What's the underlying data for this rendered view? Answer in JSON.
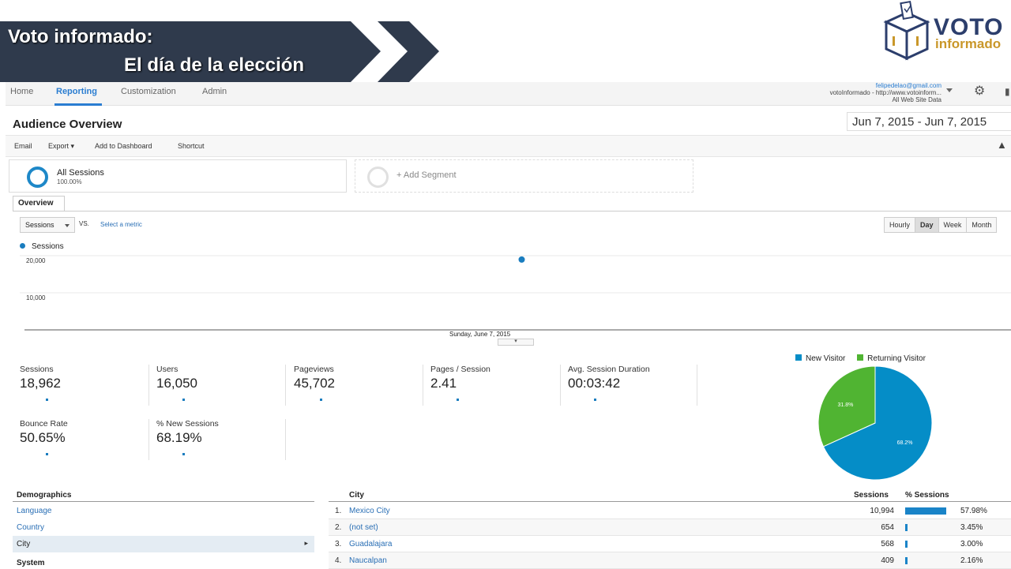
{
  "banner": {
    "line1": "Voto informado:",
    "line2": "El día de la elección"
  },
  "logo": {
    "word1": "VOTO",
    "word2": "informado"
  },
  "nav": {
    "items": [
      "Home",
      "Reporting",
      "Customization",
      "Admin"
    ],
    "active": "Reporting"
  },
  "account": {
    "email": "felipedelao@gmail.com",
    "property": "votoInformado - http://www.votoinform...",
    "view": "All Web Site Data"
  },
  "page": {
    "title": "Audience Overview",
    "date_range": "Jun 7, 2015 - Jun 7, 2015"
  },
  "actions": [
    "Email",
    "Export ▾",
    "Add to Dashboard",
    "Shortcut"
  ],
  "segments": {
    "all_name": "All Sessions",
    "all_pct": "100.00%",
    "add_label": "+ Add Segment"
  },
  "tabs": {
    "overview": "Overview"
  },
  "chart_controls": {
    "metric": "Sessions",
    "vs": "VS.",
    "select_metric": "Select a metric",
    "granularity": [
      "Hourly",
      "Day",
      "Week",
      "Month"
    ],
    "active_granularity": "Day"
  },
  "chart_data": {
    "type": "line",
    "series": [
      {
        "name": "Sessions",
        "x": [
          "Sunday, June 7, 2015"
        ],
        "values": [
          18962
        ]
      }
    ],
    "y_ticks": [
      "20,000",
      "10,000"
    ],
    "ylim": [
      0,
      20000
    ],
    "x_label_shown": "Sunday, June 7, 2015",
    "color": "#1a7dbf"
  },
  "metrics": [
    {
      "label": "Sessions",
      "value": "18,962"
    },
    {
      "label": "Users",
      "value": "16,050"
    },
    {
      "label": "Pageviews",
      "value": "45,702"
    },
    {
      "label": "Pages / Session",
      "value": "2.41"
    },
    {
      "label": "Avg. Session Duration",
      "value": "00:03:42"
    },
    {
      "label": "Bounce Rate",
      "value": "50.65%"
    },
    {
      "label": "% New Sessions",
      "value": "68.19%"
    }
  ],
  "pie": {
    "type": "pie",
    "legend": [
      {
        "name": "New Visitor",
        "color": "#058dc7"
      },
      {
        "name": "Returning Visitor",
        "color": "#50b432"
      }
    ],
    "slices": [
      {
        "name": "New Visitor",
        "value": 68.2,
        "label": "68.2%"
      },
      {
        "name": "Returning Visitor",
        "value": 31.8,
        "label": "31.8%"
      }
    ]
  },
  "demographics": {
    "title": "Demographics",
    "items": [
      "Language",
      "Country",
      "City"
    ],
    "selected": "City",
    "system_title": "System"
  },
  "city_table": {
    "headers": {
      "city": "City",
      "sessions": "Sessions",
      "pct": "% Sessions"
    },
    "rows": [
      {
        "num": "1.",
        "city": "Mexico City",
        "sessions": "10,994",
        "pct": "57.98%",
        "share": 57.98
      },
      {
        "num": "2.",
        "city": "(not set)",
        "sessions": "654",
        "pct": "3.45%",
        "share": 3.45
      },
      {
        "num": "3.",
        "city": "Guadalajara",
        "sessions": "568",
        "pct": "3.00%",
        "share": 3.0
      },
      {
        "num": "4.",
        "city": "Naucalpan",
        "sessions": "409",
        "pct": "2.16%",
        "share": 2.16
      }
    ]
  }
}
